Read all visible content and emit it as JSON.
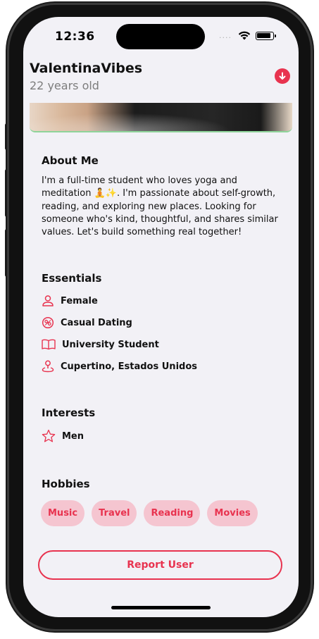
{
  "status": {
    "time": "12:36",
    "signal_dots": "....",
    "wifi_icon": "wifi-icon",
    "battery_icon": "battery-icon"
  },
  "profile": {
    "name": "ValentinaVibes",
    "age": "22 years old"
  },
  "colors": {
    "accent": "#e8334f",
    "chip_bg": "#f5c5d0",
    "screen_bg": "#f2f1f6"
  },
  "about": {
    "title": "About Me",
    "text": "I'm a full-time student who loves yoga and meditation 🧘✨. I'm passionate about self-growth, reading, and exploring new places. Looking for someone who's kind, thoughtful, and shares similar values. Let's build something real together!"
  },
  "essentials": {
    "title": "Essentials",
    "items": [
      {
        "icon": "person-icon",
        "label": "Female"
      },
      {
        "icon": "relationship-icon",
        "label": "Casual Dating"
      },
      {
        "icon": "book-icon",
        "label": "University Student"
      },
      {
        "icon": "location-pin-icon",
        "label": "Cupertino, Estados Unidos"
      }
    ]
  },
  "interests": {
    "title": "Interests",
    "items": [
      {
        "icon": "star-icon",
        "label": "Men"
      }
    ]
  },
  "hobbies": {
    "title": "Hobbies",
    "items": [
      "Music",
      "Travel",
      "Reading",
      "Movies"
    ]
  },
  "actions": {
    "report_label": "Report User",
    "download_icon": "arrow-down-icon"
  }
}
